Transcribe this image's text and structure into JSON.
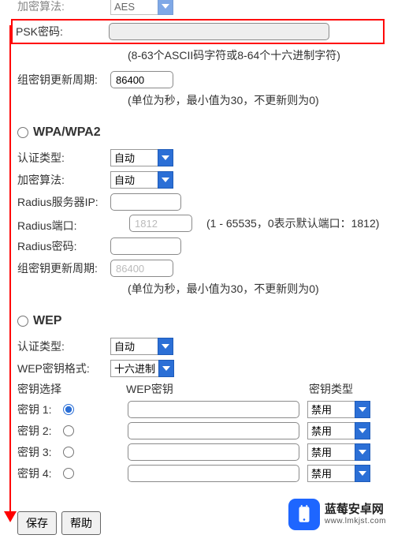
{
  "top": {
    "algo_label": "加密算法:",
    "algo_value": "AES",
    "psk_label": "PSK密码:",
    "psk_value": "",
    "psk_hint": "(8-63个ASCII码字符或8-64个十六进制字符)",
    "rekey_label": "组密钥更新周期:",
    "rekey_value": "86400",
    "rekey_hint": "(单位为秒，最小值为30，不更新则为0)"
  },
  "wpa": {
    "title": "WPA/WPA2",
    "auth_label": "认证类型:",
    "auth_value": "自动",
    "algo_label": "加密算法:",
    "algo_value": "自动",
    "radius_ip_label": "Radius服务器IP:",
    "radius_ip_value": "",
    "radius_port_label": "Radius端口:",
    "radius_port_value": "1812",
    "radius_port_hint": "(1 - 65535，0表示默认端口：1812)",
    "radius_pw_label": "Radius密码:",
    "radius_pw_value": "",
    "rekey_label": "组密钥更新周期:",
    "rekey_value": "86400",
    "rekey_hint": "(单位为秒，最小值为30，不更新则为0)"
  },
  "wep": {
    "title": "WEP",
    "auth_label": "认证类型:",
    "auth_value": "自动",
    "format_label": "WEP密钥格式:",
    "format_value": "十六进制",
    "header_select": "密钥选择",
    "header_key": "WEP密钥",
    "header_type": "密钥类型",
    "keys": [
      {
        "label": "密钥 1:",
        "value": "",
        "type": "禁用",
        "checked": true
      },
      {
        "label": "密钥 2:",
        "value": "",
        "type": "禁用",
        "checked": false
      },
      {
        "label": "密钥 3:",
        "value": "",
        "type": "禁用",
        "checked": false
      },
      {
        "label": "密钥 4:",
        "value": "",
        "type": "禁用",
        "checked": false
      }
    ]
  },
  "buttons": {
    "save": "保存",
    "help": "帮助"
  },
  "watermark": {
    "title": "蓝莓安卓网",
    "url": "www.lmkjst.com"
  }
}
